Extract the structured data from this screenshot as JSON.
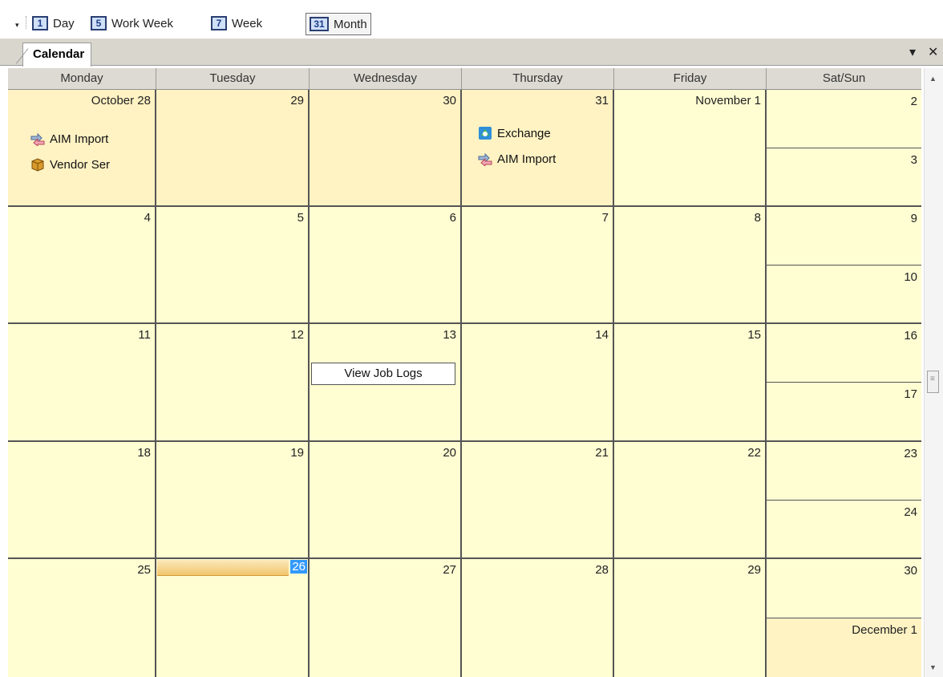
{
  "toolbar": {
    "buttons": [
      {
        "num": "1",
        "label": "Day"
      },
      {
        "num": "5",
        "label": "Work Week"
      },
      {
        "num": "7",
        "label": "Week"
      },
      {
        "num": "31",
        "label": "Month"
      }
    ],
    "active": "Month"
  },
  "tab": {
    "label": "Calendar"
  },
  "days_header": [
    "Monday",
    "Tuesday",
    "Wednesday",
    "Thursday",
    "Friday",
    "Sat/Sun"
  ],
  "weeks": [
    {
      "mon": "October 28",
      "tue": "29",
      "wed": "30",
      "thu": "31",
      "fri": "November 1",
      "sat": "2",
      "sun": "3"
    },
    {
      "mon": "4",
      "tue": "5",
      "wed": "6",
      "thu": "7",
      "fri": "8",
      "sat": "9",
      "sun": "10"
    },
    {
      "mon": "11",
      "tue": "12",
      "wed": "13",
      "thu": "14",
      "fri": "15",
      "sat": "16",
      "sun": "17"
    },
    {
      "mon": "18",
      "tue": "19",
      "wed": "20",
      "thu": "21",
      "fri": "22",
      "sat": "23",
      "sun": "24"
    },
    {
      "mon": "25",
      "tue": "26",
      "wed": "27",
      "thu": "28",
      "fri": "29",
      "sat": "30",
      "sun": "December 1"
    }
  ],
  "events": {
    "oct28": [
      {
        "label": "AIM Import",
        "icon": "aim-import-icon"
      },
      {
        "label": "Vendor Ser",
        "icon": "vendor-service-icon"
      }
    ],
    "oct31": [
      {
        "label": "Exchange",
        "icon": "exchange-icon"
      },
      {
        "label": "AIM Import",
        "icon": "aim-import-icon"
      }
    ]
  },
  "context_item": {
    "label": "View Job Logs"
  },
  "colors": {
    "current_month_bg": "#fffdd2",
    "other_month_bg": "#fff2c3",
    "today_highlight": "#3399ff"
  }
}
